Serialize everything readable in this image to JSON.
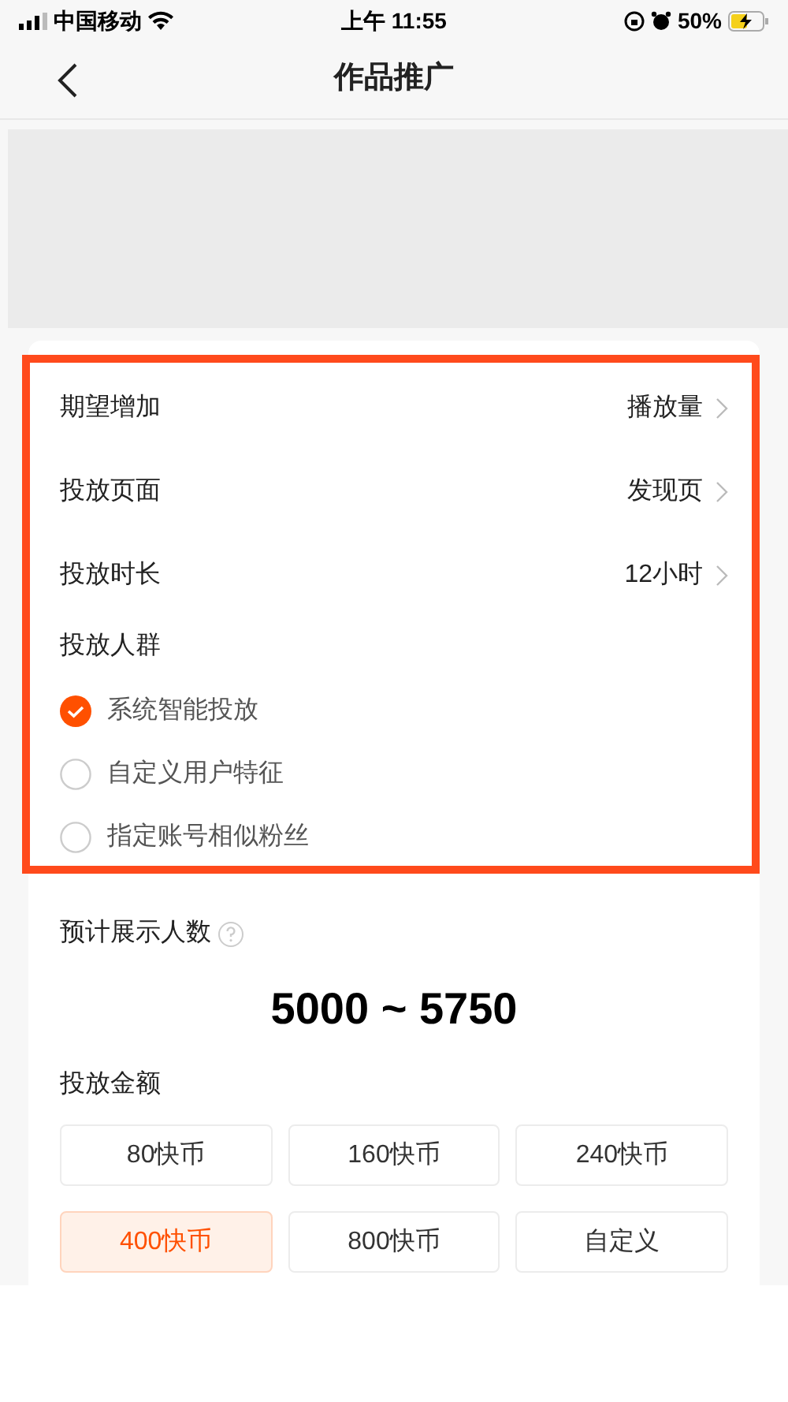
{
  "status_bar": {
    "carrier": "中国移动",
    "time": "上午 11:55",
    "battery": "50%"
  },
  "nav": {
    "title": "作品推广"
  },
  "settings": [
    {
      "label": "期望增加",
      "value": "播放量"
    },
    {
      "label": "投放页面",
      "value": "发现页"
    },
    {
      "label": "投放时长",
      "value": "12小时"
    }
  ],
  "audience": {
    "label": "投放人群",
    "options": [
      {
        "label": "系统智能投放",
        "selected": true
      },
      {
        "label": "自定义用户特征",
        "selected": false
      },
      {
        "label": "指定账号相似粉丝",
        "selected": false
      }
    ]
  },
  "estimate": {
    "label": "预计展示人数",
    "value": "5000 ~ 5750"
  },
  "amount": {
    "label": "投放金额",
    "options": [
      {
        "label": "80快币",
        "selected": false
      },
      {
        "label": "160快币",
        "selected": false
      },
      {
        "label": "240快币",
        "selected": false
      },
      {
        "label": "400快币",
        "selected": true
      },
      {
        "label": "800快币",
        "selected": false
      },
      {
        "label": "自定义",
        "selected": false
      }
    ]
  }
}
